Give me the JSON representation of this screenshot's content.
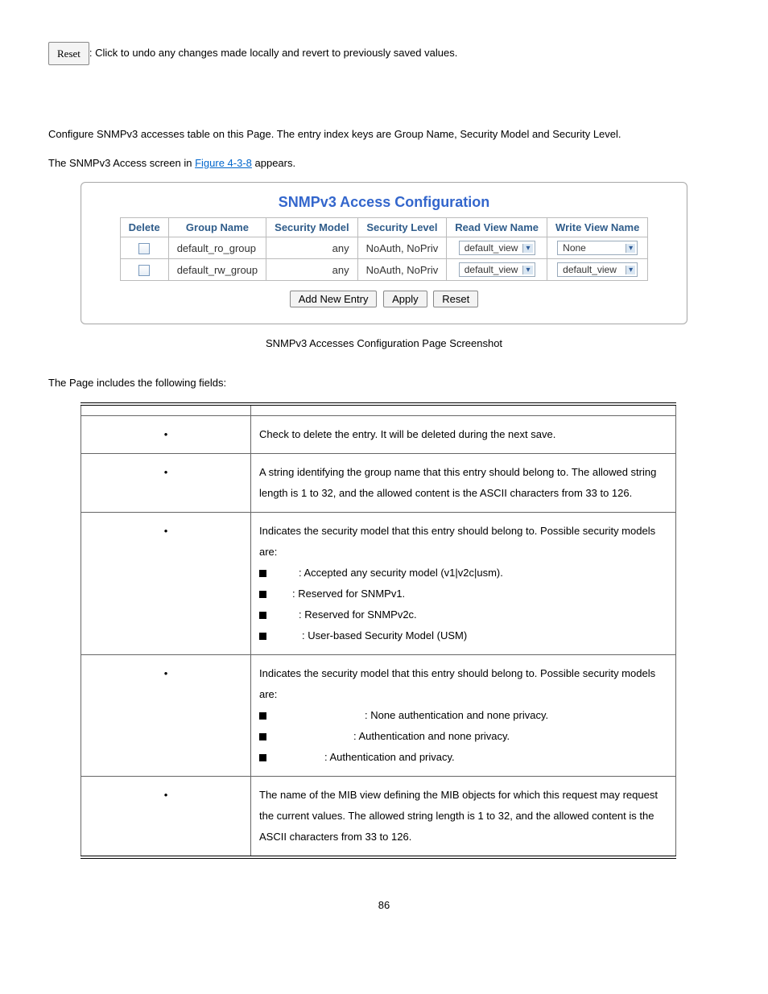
{
  "top": {
    "reset_label": "Reset",
    "reset_desc": ": Click to undo any changes made locally and revert to previously saved values."
  },
  "intro": {
    "line1": "Configure SNMPv3 accesses table on this Page. The entry index keys are Group Name, Security Model and Security Level.",
    "line2a": "The SNMPv3 Access screen in ",
    "figlink": "Figure 4-3-8",
    "line2b": " appears."
  },
  "shot": {
    "title": "SNMPv3 Access Configuration",
    "headers": [
      "Delete",
      "Group Name",
      "Security Model",
      "Security Level",
      "Read View Name",
      "Write View Name"
    ],
    "rows": [
      {
        "group": "default_ro_group",
        "model": "any",
        "level": "NoAuth, NoPriv",
        "read": "default_view",
        "write": "None"
      },
      {
        "group": "default_rw_group",
        "model": "any",
        "level": "NoAuth, NoPriv",
        "read": "default_view",
        "write": "default_view"
      }
    ],
    "buttons": {
      "add": "Add New Entry",
      "apply": "Apply",
      "reset": "Reset"
    },
    "caption": "SNMPv3 Accesses Configuration Page Screenshot"
  },
  "fields_intro": "The Page includes the following fields:",
  "fields": {
    "r1": "Check to delete the entry. It will be deleted during the next save.",
    "r2": "A string identifying the group name that this entry should belong to. The allowed string length is 1 to 32, and the allowed content is the ASCII characters from 33 to 126.",
    "r3_intro": "Indicates the security model that this entry should belong to. Possible security models are:",
    "r3_items": [
      ": Accepted any security model (v1|v2c|usm).",
      ": Reserved for SNMPv1.",
      ": Reserved for SNMPv2c.",
      ": User-based Security Model (USM)"
    ],
    "r4_intro": "Indicates the security model that this entry should belong to. Possible security models are:",
    "r4_items": [
      ": None authentication and none privacy.",
      ": Authentication and none privacy.",
      ": Authentication and privacy."
    ],
    "r5": "The name of the MIB view defining the MIB objects for which this request may request the current values. The allowed string length is 1 to 32, and the allowed content is the ASCII characters from 33 to 126."
  },
  "page_number": "86"
}
